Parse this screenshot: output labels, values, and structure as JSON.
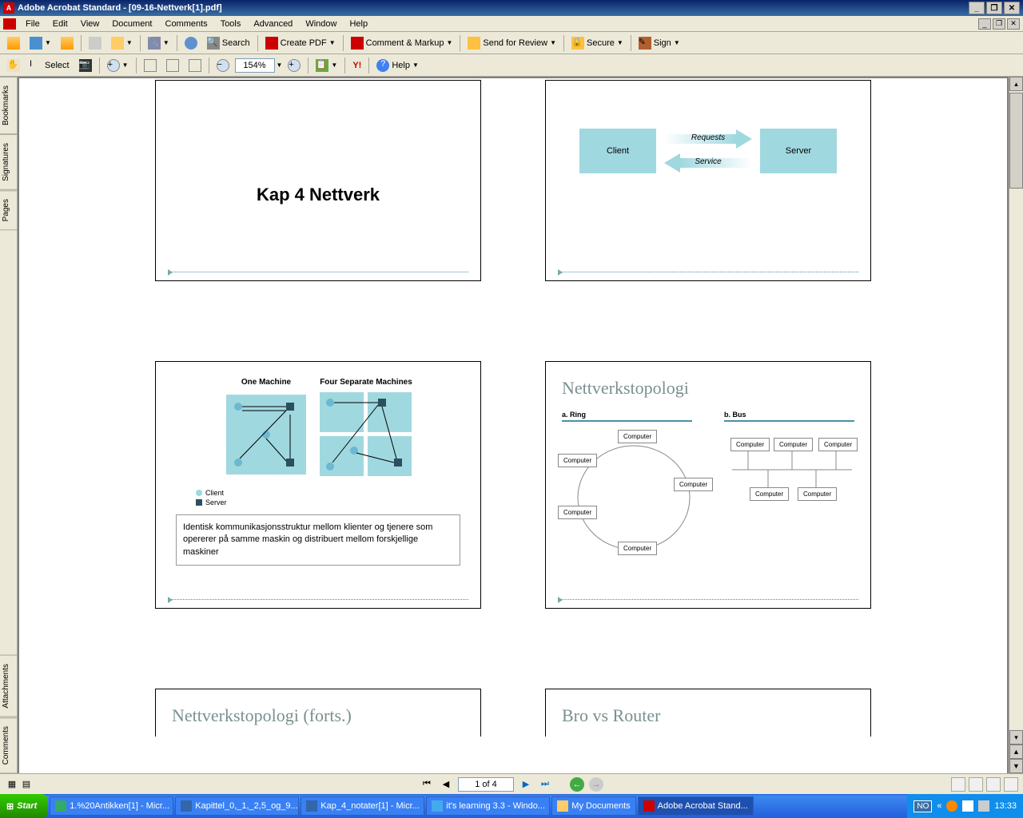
{
  "titlebar": {
    "text": "Adobe Acrobat Standard - [09-16-Nettverk[1].pdf]"
  },
  "menu": {
    "items": [
      "File",
      "Edit",
      "View",
      "Document",
      "Comments",
      "Tools",
      "Advanced",
      "Window",
      "Help"
    ]
  },
  "toolbar1": {
    "search": "Search",
    "createpdf": "Create PDF",
    "comment": "Comment & Markup",
    "send": "Send for Review",
    "secure": "Secure",
    "sign": "Sign"
  },
  "toolbar2": {
    "select": "Select",
    "zoom": "154%",
    "help": "Help",
    "yahoo": "Y!"
  },
  "sidetabs": [
    "Bookmarks",
    "Signatures",
    "Pages",
    "Attachments",
    "Comments"
  ],
  "slides": {
    "s1": {
      "title": "Kap 4 Nettverk"
    },
    "s2": {
      "client": "Client",
      "server": "Server",
      "requests": "Requests",
      "service": "Service"
    },
    "s3": {
      "col1": "One Machine",
      "col2": "Four Separate Machines",
      "legend_client": "Client",
      "legend_server": "Server",
      "desc": "Identisk kommunikasjonsstruktur mellom klienter og tjenere som opererer på samme maskin og distribuert mellom forskjellige maskiner"
    },
    "s4": {
      "title": "Nettverkstopologi",
      "ring": "a. Ring",
      "bus": "b. Bus",
      "computer": "Computer"
    },
    "s5": {
      "title": "Nettverkstopologi (forts.)"
    },
    "s6": {
      "title": "Bro vs Router"
    }
  },
  "nav": {
    "page": "1 of 4"
  },
  "taskbar": {
    "start": "Start",
    "items": [
      "1.%20Antikken[1] - Micr...",
      "Kapittel_0,_1,_2,5_og_9...",
      "Kap_4_notater[1] - Micr...",
      "it's learning 3.3 - Windo...",
      "My Documents",
      "Adobe Acrobat Stand..."
    ],
    "lang": "NO",
    "time": "13:33"
  }
}
